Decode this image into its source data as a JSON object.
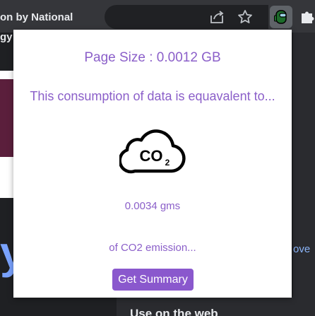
{
  "browser": {
    "tab_title": "on by National",
    "tab_title_line2": "gy",
    "icons": [
      "share-icon",
      "star-icon",
      "extension-icon",
      "puzzle-icon"
    ]
  },
  "background_page": {
    "big_letter": "y",
    "right_text": "ove",
    "bottom_text": "Use on the web"
  },
  "popup": {
    "page_size": "Page Size : 0.0012 GB",
    "equivalent_text": "This consumption of data is equavalent to...",
    "cloud_icon_label": "CO",
    "cloud_icon_subscript": "2",
    "co2_amount": "0.0034 gms",
    "emission_text": "of CO2 emission...",
    "summary_button": "Get Summary"
  },
  "colors": {
    "accent_purple": "#8a58cd",
    "text_purple": "#8b5fc9",
    "chrome_dark": "#35363a"
  }
}
